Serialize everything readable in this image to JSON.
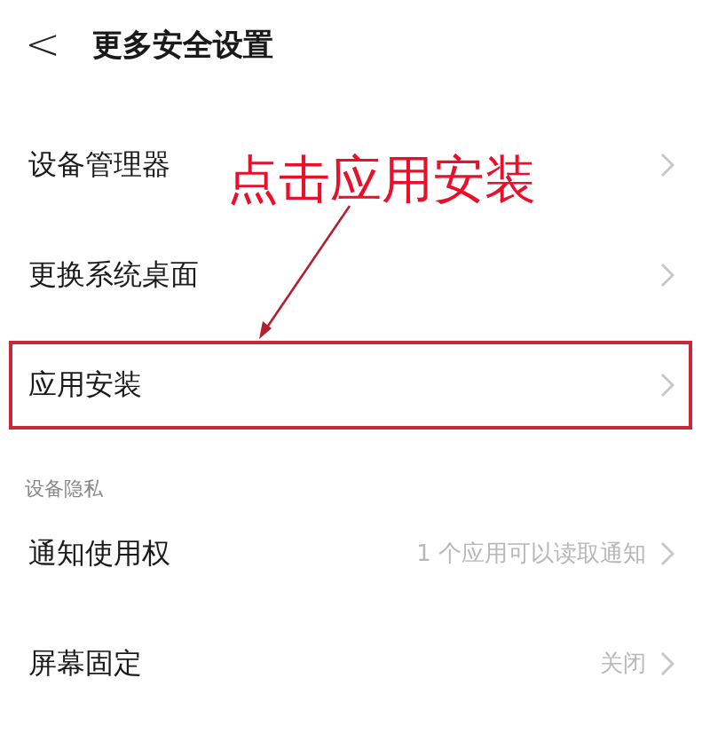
{
  "header": {
    "back": "<",
    "title": "更多安全设置"
  },
  "sections": [
    {
      "items": [
        {
          "label": "设备管理器",
          "highlighted": false
        },
        {
          "label": "更换系统桌面",
          "highlighted": false
        },
        {
          "label": "应用安装",
          "highlighted": true
        }
      ]
    },
    {
      "title": "设备隐私",
      "items": [
        {
          "label": "通知使用权",
          "value": "1 个应用可以读取通知",
          "highlighted": false
        },
        {
          "label": "屏幕固定",
          "value": "关闭",
          "highlighted": false
        }
      ]
    }
  ],
  "annotation": {
    "text": "点击应用安装"
  }
}
